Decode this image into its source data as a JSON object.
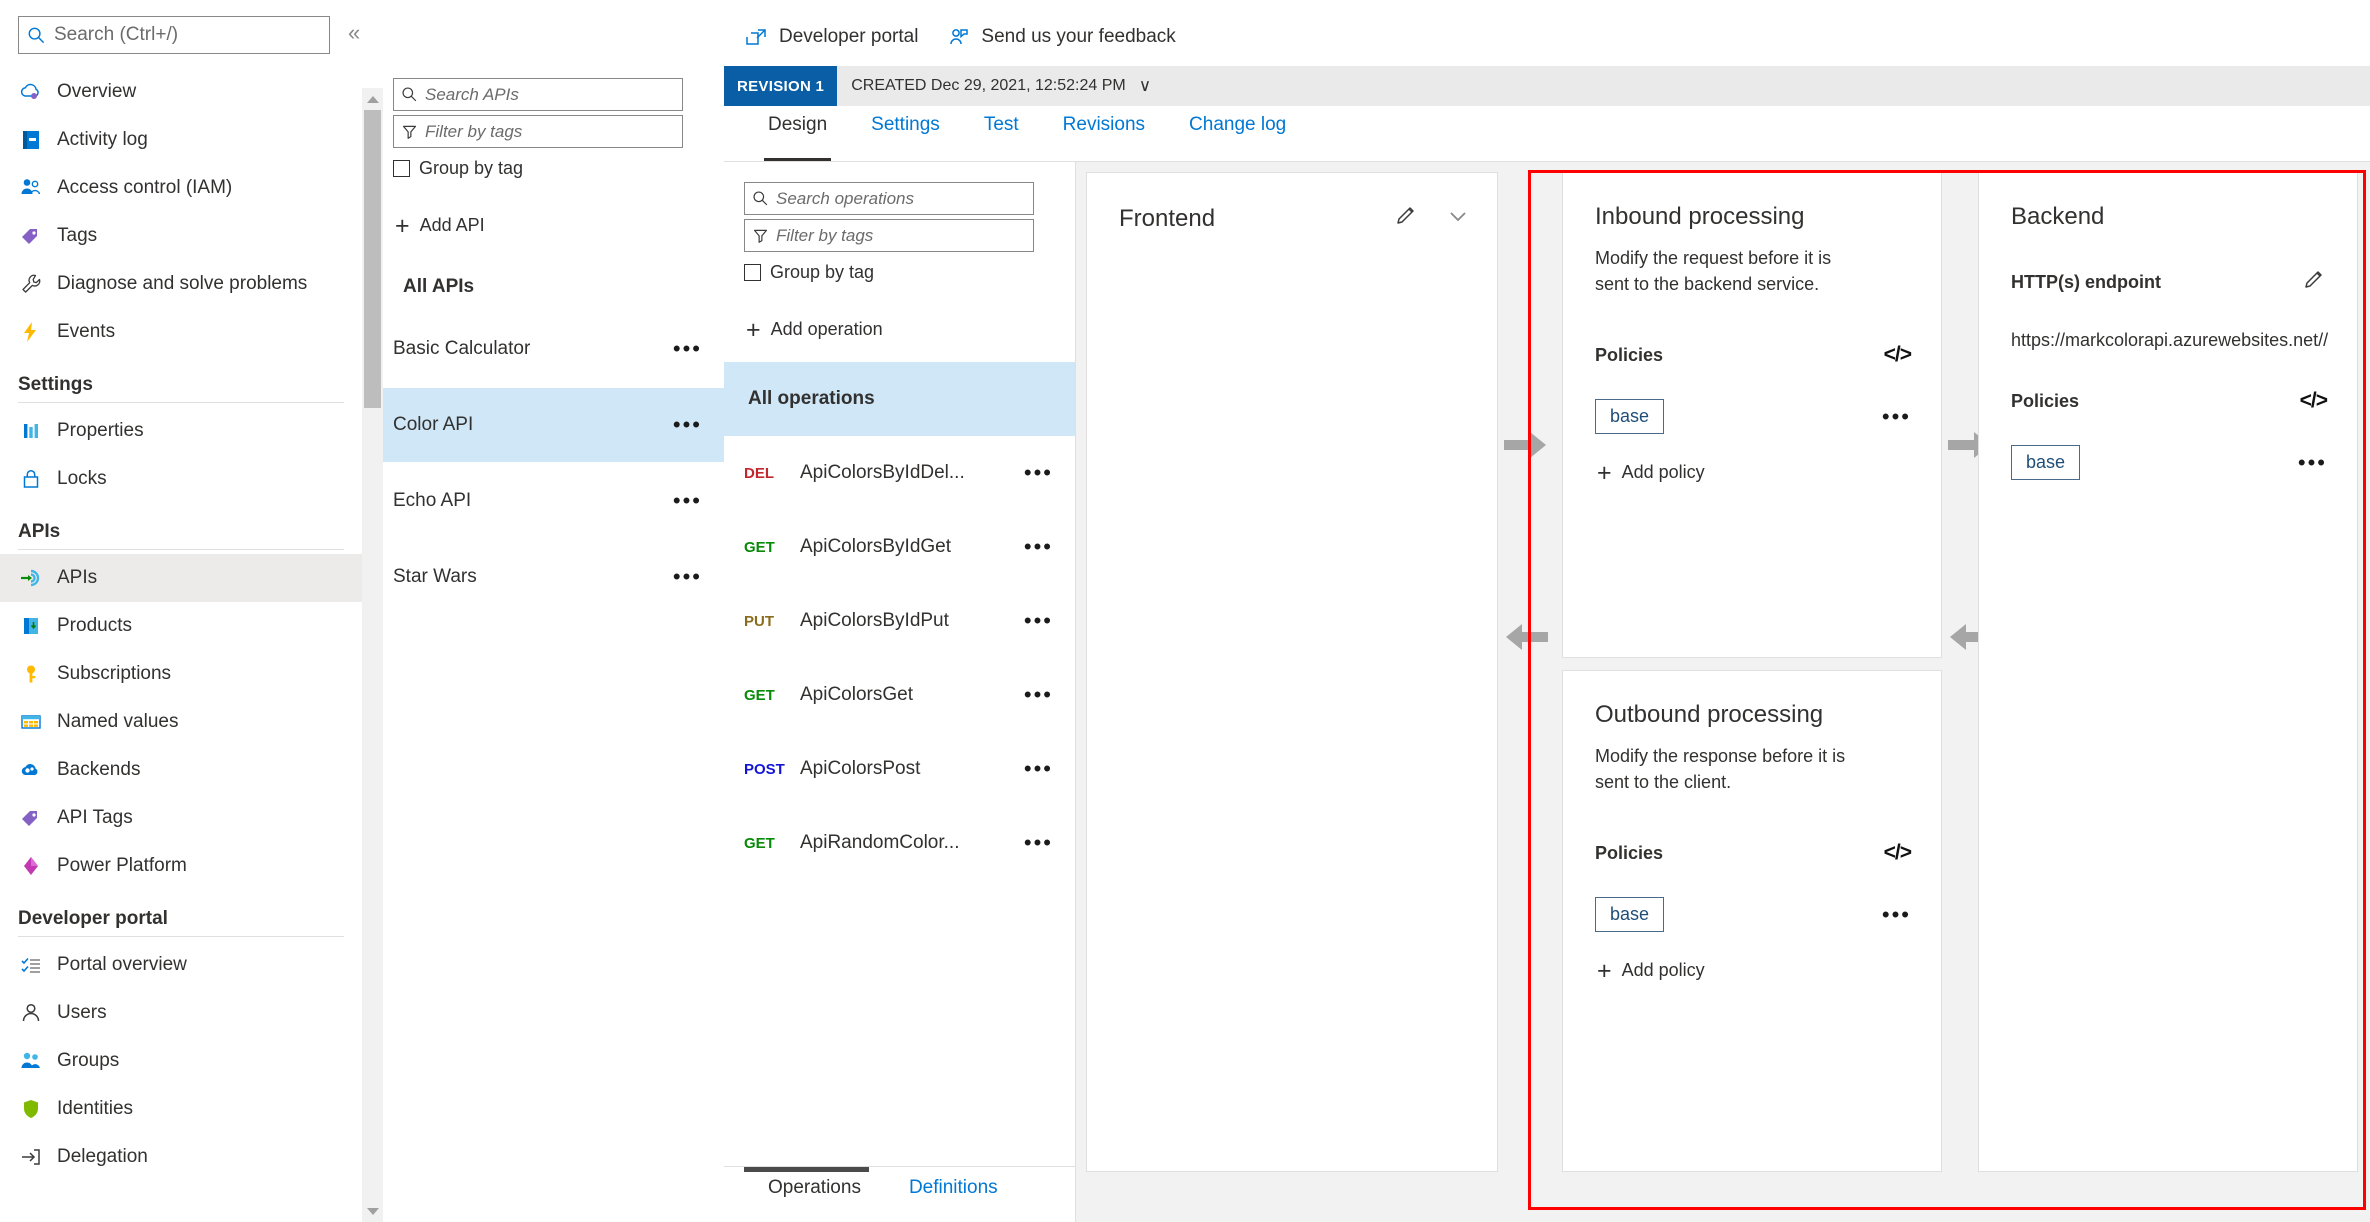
{
  "leftnav": {
    "search": {
      "placeholder": "Search (Ctrl+/)",
      "icon": "search-icon"
    },
    "collapse_label": "«",
    "items": [
      {
        "label": "Overview",
        "icon": "cloud-overview-icon",
        "selected": false
      },
      {
        "label": "Activity log",
        "icon": "activity-log-icon",
        "selected": false
      },
      {
        "label": "Access control (IAM)",
        "icon": "people-icon",
        "selected": false
      },
      {
        "label": "Tags",
        "icon": "tag-icon",
        "selected": false
      },
      {
        "label": "Diagnose and solve problems",
        "icon": "wrench-icon",
        "selected": false
      },
      {
        "label": "Events",
        "icon": "lightning-icon",
        "selected": false
      }
    ],
    "sections": [
      {
        "title": "Settings",
        "items": [
          {
            "label": "Properties",
            "icon": "properties-icon",
            "selected": false
          },
          {
            "label": "Locks",
            "icon": "lock-icon",
            "selected": false
          }
        ]
      },
      {
        "title": "APIs",
        "items": [
          {
            "label": "APIs",
            "icon": "apis-icon",
            "selected": true
          },
          {
            "label": "Products",
            "icon": "products-icon",
            "selected": false
          },
          {
            "label": "Subscriptions",
            "icon": "key-icon",
            "selected": false
          },
          {
            "label": "Named values",
            "icon": "table-icon",
            "selected": false
          },
          {
            "label": "Backends",
            "icon": "backends-cloud-icon",
            "selected": false
          },
          {
            "label": "API Tags",
            "icon": "tag-icon",
            "selected": false
          },
          {
            "label": "Power Platform",
            "icon": "power-platform-icon",
            "selected": false
          }
        ]
      },
      {
        "title": "Developer portal",
        "items": [
          {
            "label": "Portal overview",
            "icon": "checklist-icon",
            "selected": false
          },
          {
            "label": "Users",
            "icon": "user-icon",
            "selected": false
          },
          {
            "label": "Groups",
            "icon": "groups-icon",
            "selected": false
          },
          {
            "label": "Identities",
            "icon": "shield-icon",
            "selected": false
          },
          {
            "label": "Delegation",
            "icon": "delegation-arrow-icon",
            "selected": false
          }
        ]
      }
    ]
  },
  "apis_panel": {
    "search": {
      "placeholder": "Search APIs",
      "icon": "search-icon"
    },
    "filter": {
      "placeholder": "Filter by tags",
      "icon": "filter-icon"
    },
    "group_by_tag_label": "Group by tag",
    "add_api_label": "Add API",
    "all_apis_label": "All APIs",
    "apis": [
      {
        "name": "Basic Calculator",
        "selected": false
      },
      {
        "name": "Color API",
        "selected": true
      },
      {
        "name": "Echo API",
        "selected": false
      },
      {
        "name": "Star Wars",
        "selected": false
      }
    ]
  },
  "toolbar": {
    "developer_portal_label": "Developer portal",
    "feedback_label": "Send us your feedback"
  },
  "revision": {
    "badge": "REVISION 1",
    "created_text": "CREATED Dec 29, 2021, 12:52:24 PM",
    "chevron": "∨"
  },
  "tabs": [
    {
      "label": "Design",
      "active": true
    },
    {
      "label": "Settings",
      "active": false
    },
    {
      "label": "Test",
      "active": false
    },
    {
      "label": "Revisions",
      "active": false
    },
    {
      "label": "Change log",
      "active": false
    }
  ],
  "operations": {
    "search": {
      "placeholder": "Search operations",
      "icon": "search-icon"
    },
    "filter": {
      "placeholder": "Filter by tags",
      "icon": "filter-icon"
    },
    "group_by_tag_label": "Group by tag",
    "add_operation_label": "Add operation",
    "all_operations_label": "All operations",
    "items": [
      {
        "verb": "DEL",
        "name": "ApiColorsByIdDel..."
      },
      {
        "verb": "GET",
        "name": "ApiColorsByIdGet"
      },
      {
        "verb": "PUT",
        "name": "ApiColorsByIdPut"
      },
      {
        "verb": "GET",
        "name": "ApiColorsGet"
      },
      {
        "verb": "POST",
        "name": "ApiColorsPost"
      },
      {
        "verb": "GET",
        "name": "ApiRandomColor..."
      }
    ],
    "bottom_tabs": [
      {
        "label": "Operations",
        "active": true
      },
      {
        "label": "Definitions",
        "active": false
      }
    ]
  },
  "designer": {
    "frontend": {
      "title": "Frontend",
      "edit_icon": "pencil-icon",
      "expand_icon": "chevron-down-icon"
    },
    "inbound": {
      "title": "Inbound processing",
      "description": "Modify the request before it is sent to the backend service.",
      "policies_label": "Policies",
      "code_icon": "code-brackets-icon",
      "policy_chip": "base",
      "add_policy_label": "Add policy",
      "more_icon": "ellipsis-icon"
    },
    "outbound": {
      "title": "Outbound processing",
      "description": "Modify the response before it is sent to the client.",
      "policies_label": "Policies",
      "code_icon": "code-brackets-icon",
      "policy_chip": "base",
      "add_policy_label": "Add policy",
      "more_icon": "ellipsis-icon"
    },
    "backend": {
      "title": "Backend",
      "endpoint_label": "HTTP(s) endpoint",
      "edit_icon": "pencil-icon",
      "url": "https://markcolorapi.azurewebsites.net//",
      "policies_label": "Policies",
      "code_icon": "code-brackets-icon",
      "policy_chip": "base",
      "more_icon": "ellipsis-icon"
    }
  },
  "colors": {
    "accent_blue": "#0078d4",
    "revision_badge_bg": "#0a5ea5",
    "selected_row_blue": "#cfe7f7",
    "selected_nav_gray": "#edebe9",
    "board_bg": "#f2f2f2",
    "annotation_red": "#ff0000",
    "verb_del": "#c4262e",
    "verb_get": "#0a8a0a",
    "verb_put": "#8a6d1c",
    "verb_post": "#1414d6"
  }
}
